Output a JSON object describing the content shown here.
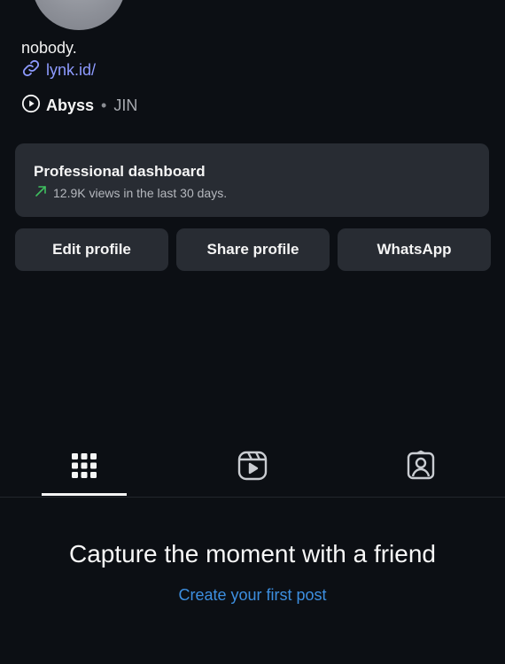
{
  "profile": {
    "bio": "nobody.",
    "link_text": "lynk.id/"
  },
  "audio": {
    "title": "Abyss",
    "separator": "•",
    "artist": "JIN"
  },
  "dashboard": {
    "title": "Professional dashboard",
    "subtitle": "12.9K views in the last 30 days.",
    "trend_color": "#3fbf5f"
  },
  "buttons": {
    "edit": "Edit profile",
    "share": "Share profile",
    "whatsapp": "WhatsApp"
  },
  "tabs": [
    {
      "name": "grid",
      "icon": "grid-icon",
      "active": true
    },
    {
      "name": "reels",
      "icon": "reels-icon",
      "active": false
    },
    {
      "name": "tagged",
      "icon": "tagged-icon",
      "active": false
    }
  ],
  "empty_state": {
    "title": "Capture the moment with a friend",
    "action": "Create your first post",
    "action_color": "#3d8fe0"
  },
  "colors": {
    "background": "#0c0f14",
    "card": "#282c33",
    "link": "#8e9bff"
  }
}
